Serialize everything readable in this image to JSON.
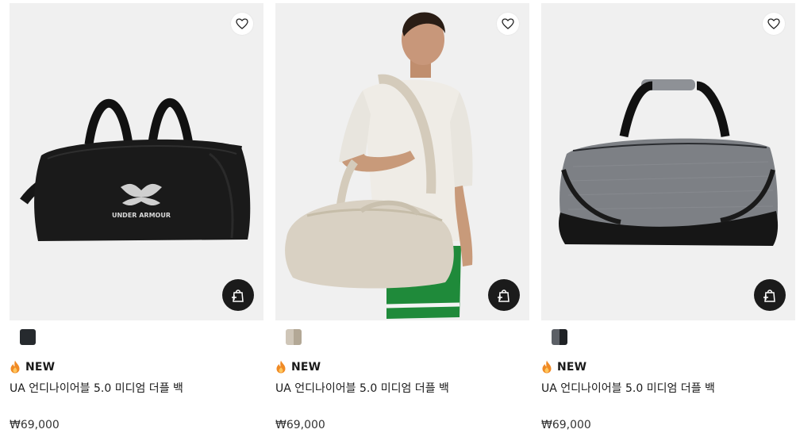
{
  "products": [
    {
      "badge": "NEW",
      "name": "UA 언디나이어블 5.0 미디엄 더플 백",
      "price": "₩69,000",
      "swatches": [
        [
          "#262a2e"
        ]
      ],
      "brand_text": "UNDER ARMOUR",
      "image_bg": "#f0f0f0",
      "icons": {
        "wish": "heart-outline-icon",
        "cart": "add-to-cart-icon",
        "badge": "fire-icon"
      }
    },
    {
      "badge": "NEW",
      "name": "UA 언디나이어블 5.0 미디엄 더플 백",
      "price": "₩69,000",
      "swatches": [
        [
          "#cfc6b8",
          "#b3a896"
        ]
      ],
      "image_bg": "#f0f0f0",
      "icons": {
        "wish": "heart-outline-icon",
        "cart": "add-to-cart-icon",
        "badge": "fire-icon"
      }
    },
    {
      "badge": "NEW",
      "name": "UA 언디나이어블 5.0 미디엄 더플 백",
      "price": "₩69,000",
      "swatches": [
        [
          "#5c6066",
          "#1f2226"
        ]
      ],
      "image_bg": "#f0f0f0",
      "icons": {
        "wish": "heart-outline-icon",
        "cart": "add-to-cart-icon",
        "badge": "fire-icon"
      }
    }
  ],
  "colors": {
    "badge_flame": "#f08a24",
    "cart_button": "#1b1b1b",
    "card_bg": "#f0f0f0"
  }
}
